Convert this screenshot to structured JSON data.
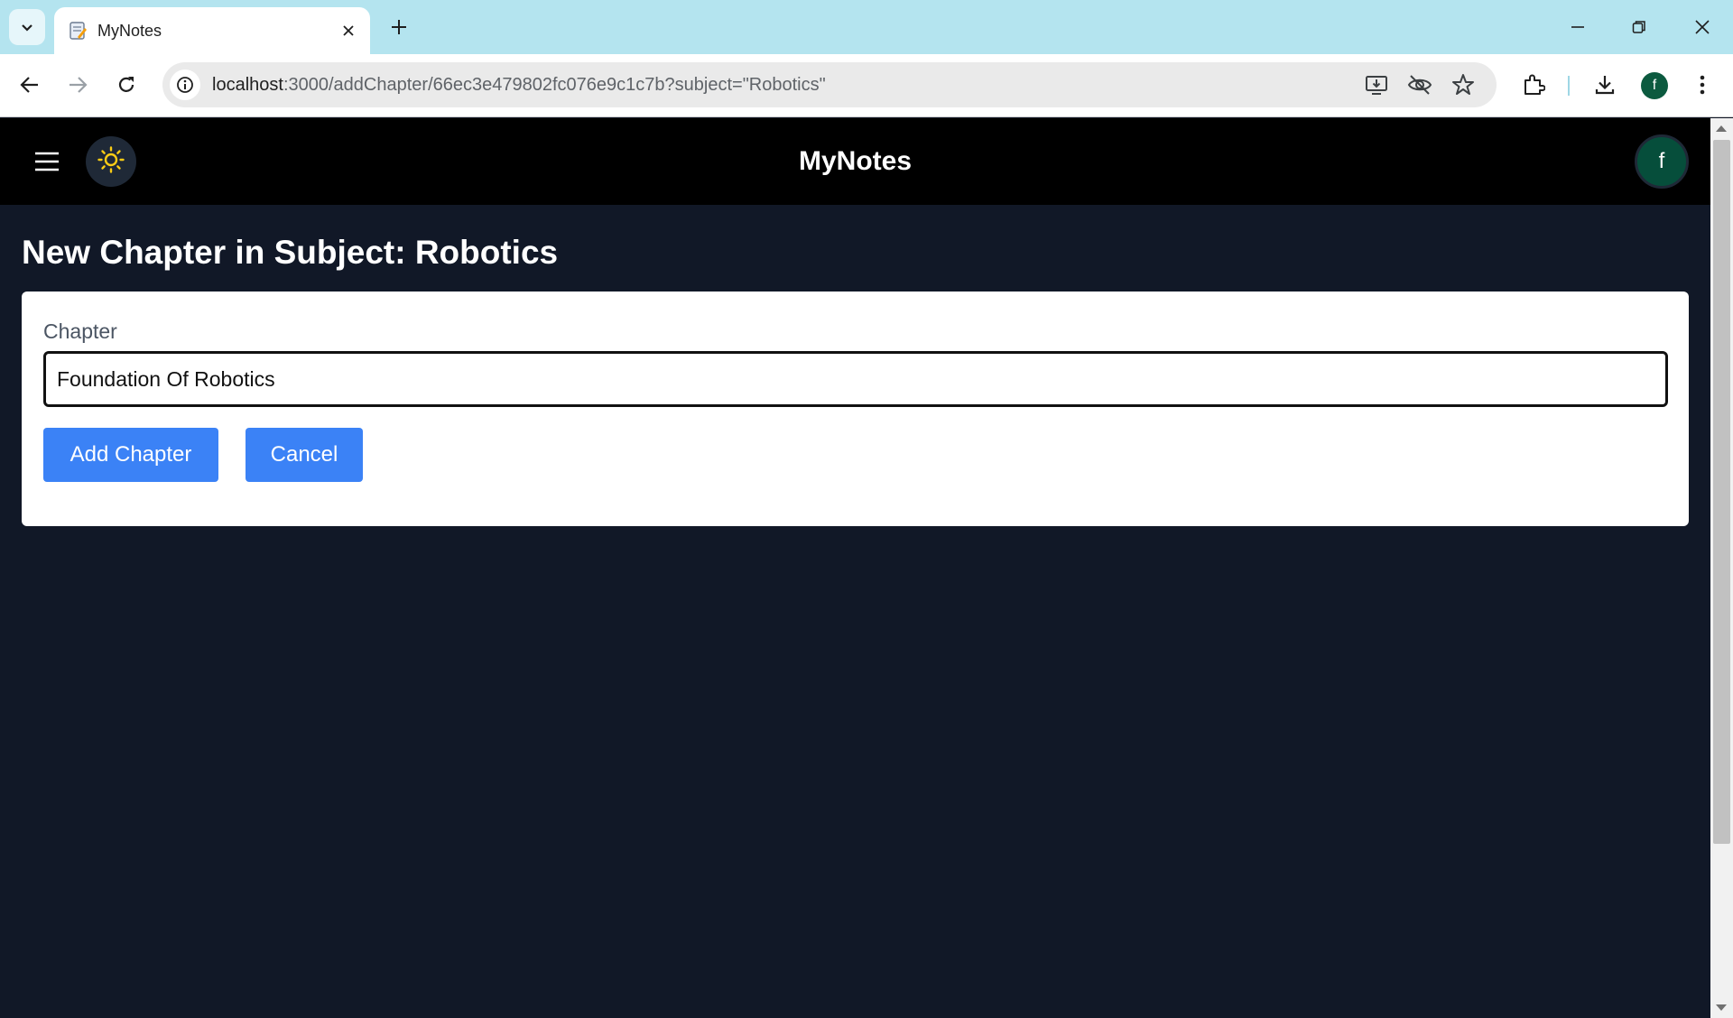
{
  "browser": {
    "tab": {
      "title": "MyNotes",
      "favicon": "notes-favicon"
    },
    "url_host": "localhost",
    "url_path": ":3000/addChapter/66ec3e479802fc076e9c1c7b?subject=\"Robotics\"",
    "profile_initial": "f",
    "icons": [
      "tab-search-icon",
      "close-icon",
      "plus-icon",
      "minimize-icon",
      "restore-icon",
      "window-close-icon",
      "back-arrow-icon",
      "forward-arrow-icon",
      "reload-icon",
      "site-info-icon",
      "install-app-icon",
      "eye-off-icon",
      "star-icon",
      "extensions-icon",
      "download-icon",
      "kebab-menu-icon"
    ]
  },
  "app": {
    "title": "MyNotes",
    "avatar_initial": "f",
    "icons": [
      "hamburger-menu-icon",
      "sun-icon"
    ]
  },
  "page": {
    "heading": "New Chapter in Subject: Robotics",
    "form": {
      "chapter_label": "Chapter",
      "chapter_value": "Foundation Of Robotics",
      "add_button": "Add Chapter",
      "cancel_button": "Cancel"
    }
  },
  "colors": {
    "page_background": "#111827",
    "header_background": "#000000",
    "button_blue": "#3b82f6",
    "avatar_green": "#064e3b",
    "tabstrip": "#b4e4ef",
    "sun_yellow": "#facc15"
  }
}
